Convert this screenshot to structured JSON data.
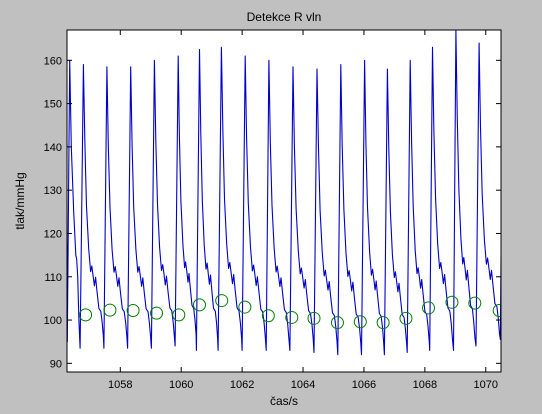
{
  "figure": {
    "background": "#c0c0c0"
  },
  "chart_data": {
    "type": "line",
    "title": "Detekce R vln",
    "xlabel": "čas/s",
    "ylabel": "tlak/mmHg",
    "xlim": [
      1056.25,
      1070.5
    ],
    "ylim": [
      88,
      167
    ],
    "xticks": [
      1058,
      1060,
      1062,
      1064,
      1066,
      1068,
      1070
    ],
    "xtick_labels": [
      "1058",
      "1060",
      "1062",
      "1064",
      "1066",
      "1068",
      "1070"
    ],
    "yticks": [
      90,
      100,
      110,
      120,
      130,
      140,
      150,
      160
    ],
    "ytick_labels": [
      "90",
      "100",
      "110",
      "120",
      "130",
      "140",
      "150",
      "160"
    ],
    "grid": false,
    "series": [
      {
        "kind": "line",
        "color": "#0000cc",
        "beats": [
          {
            "t_min": 1056.68,
            "y_min": 93.5,
            "t_peak": 1056.79,
            "y_peak": 159
          },
          {
            "t_min": 1057.46,
            "y_min": 93.5,
            "t_peak": 1057.56,
            "y_peak": 158.5
          },
          {
            "t_min": 1058.24,
            "y_min": 93.5,
            "t_peak": 1058.34,
            "y_peak": 158.5
          },
          {
            "t_min": 1059.02,
            "y_min": 93.5,
            "t_peak": 1059.12,
            "y_peak": 160
          },
          {
            "t_min": 1059.8,
            "y_min": 94,
            "t_peak": 1059.9,
            "y_peak": 161
          },
          {
            "t_min": 1060.5,
            "y_min": 93,
            "t_peak": 1060.6,
            "y_peak": 162.5
          },
          {
            "t_min": 1061.21,
            "y_min": 93,
            "t_peak": 1061.32,
            "y_peak": 163
          },
          {
            "t_min": 1062.0,
            "y_min": 93,
            "t_peak": 1062.1,
            "y_peak": 161
          },
          {
            "t_min": 1062.79,
            "y_min": 93,
            "t_peak": 1062.88,
            "y_peak": 160
          },
          {
            "t_min": 1063.57,
            "y_min": 93,
            "t_peak": 1063.67,
            "y_peak": 158.5
          },
          {
            "t_min": 1064.36,
            "y_min": 92.5,
            "t_peak": 1064.46,
            "y_peak": 158
          },
          {
            "t_min": 1065.14,
            "y_min": 92,
            "t_peak": 1065.24,
            "y_peak": 159
          },
          {
            "t_min": 1065.92,
            "y_min": 92,
            "t_peak": 1066.02,
            "y_peak": 160
          },
          {
            "t_min": 1066.67,
            "y_min": 92,
            "t_peak": 1066.77,
            "y_peak": 158
          },
          {
            "t_min": 1067.42,
            "y_min": 92.5,
            "t_peak": 1067.52,
            "y_peak": 160
          },
          {
            "t_min": 1068.16,
            "y_min": 93,
            "t_peak": 1068.25,
            "y_peak": 163
          },
          {
            "t_min": 1068.94,
            "y_min": 93,
            "t_peak": 1069.02,
            "y_peak": 167
          },
          {
            "t_min": 1069.68,
            "y_min": 94,
            "t_peak": 1069.78,
            "y_peak": 164
          },
          {
            "t_min": 1070.48,
            "y_min": 95.5,
            "t_peak": 1070.55,
            "y_peak": 160
          }
        ]
      },
      {
        "kind": "markers",
        "marker": "circle",
        "color": "#008000",
        "x": [
          1056.86,
          1057.66,
          1058.42,
          1059.19,
          1059.92,
          1060.6,
          1061.33,
          1062.09,
          1062.86,
          1063.63,
          1064.36,
          1065.13,
          1065.88,
          1066.63,
          1067.38,
          1068.12,
          1068.89,
          1069.64,
          1070.44
        ],
        "y": [
          101.2,
          102.3,
          102.2,
          101.6,
          101.2,
          103.5,
          104.5,
          103.0,
          101.0,
          100.6,
          100.4,
          99.4,
          99.6,
          99.4,
          100.4,
          102.8,
          104.1,
          103.9,
          102.2
        ]
      }
    ]
  }
}
